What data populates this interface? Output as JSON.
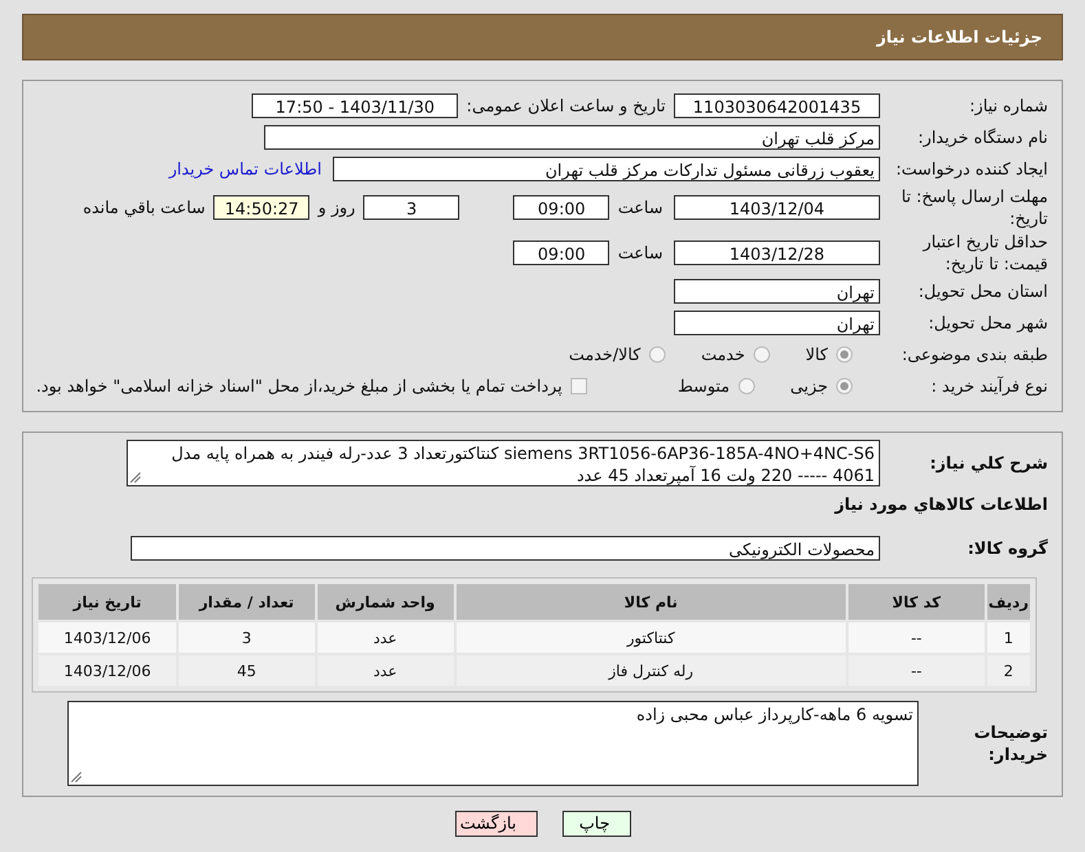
{
  "header": {
    "title": "جزئیات اطلاعات نیاز"
  },
  "need_number": {
    "label": "شماره نیاز:",
    "value": "1103030642001435"
  },
  "announce": {
    "label": "تاریخ و ساعت اعلان عمومی:",
    "value": "1403/11/30 - 17:50"
  },
  "buyer_org": {
    "label": "نام دستگاه خریدار:",
    "value": "مرکز قلب تهران"
  },
  "requester": {
    "label": "ایجاد کننده درخواست:",
    "value": "یعقوب زرقانی مسئول تدارکات مرکز قلب تهران",
    "link": "اطلاعات تماس خریدار"
  },
  "reply_deadline": {
    "label": "مهلت ارسال پاسخ: تا تاریخ:",
    "date": "1403/12/04",
    "time_label": "ساعت",
    "time": "09:00",
    "days": "3",
    "days_label": "روز و",
    "remaining": "14:50:27",
    "remaining_label": "ساعت باقي مانده"
  },
  "price_validity": {
    "label": "حداقل تاریخ اعتبار قیمت: تا تاریخ:",
    "date": "1403/12/28",
    "time_label": "ساعت",
    "time": "09:00"
  },
  "province": {
    "label": "استان محل تحویل:",
    "value": "تهران"
  },
  "city": {
    "label": "شهر محل تحویل:",
    "value": "تهران"
  },
  "category": {
    "label": "طبقه بندی موضوعی:",
    "options": [
      {
        "label": "کالا",
        "selected": true
      },
      {
        "label": "خدمت",
        "selected": false
      },
      {
        "label": "کالا/خدمت",
        "selected": false
      }
    ]
  },
  "process": {
    "label": "نوع فرآیند خرید :",
    "options": [
      {
        "label": "جزیی",
        "selected": true
      },
      {
        "label": "متوسط",
        "selected": false
      }
    ],
    "treasury": {
      "label": "پرداخت تمام یا بخشی از مبلغ خرید،از محل \"اسناد خزانه اسلامی\" خواهد بود.",
      "checked": false
    }
  },
  "description": {
    "label": "شرح کلي نیاز:",
    "text": "siemens 3RT1056-6AP36-185A-4NO+4NC-S6 کنتاکتورتعداد 3 عدد-رله فیندر به همراه پایه مدل 4061 ----- 220 ولت 16 آمپرتعداد 45 عدد"
  },
  "goods_heading": "اطلاعات کالاهاي مورد نیاز",
  "goods_group": {
    "label": "گروه کالا:",
    "value": "محصولات الکترونیکی"
  },
  "table": {
    "columns": [
      "ردیف",
      "کد کالا",
      "نام کالا",
      "واحد شمارش",
      "تعداد / مقدار",
      "تاریخ نیاز"
    ],
    "rows": [
      [
        "1",
        "--",
        "کنتاکتور",
        "عدد",
        "3",
        "1403/12/06"
      ],
      [
        "2",
        "--",
        "رله کنترل فاز",
        "عدد",
        "45",
        "1403/12/06"
      ]
    ]
  },
  "buyer_notes": {
    "label": "توضیحات خریدار:",
    "text": "تسویه 6 ماهه-کارپرداز عباس محبی زاده"
  },
  "buttons": [
    {
      "label": "چاپ",
      "kind": "print"
    },
    {
      "label": "بازگشت",
      "kind": "back"
    }
  ]
}
